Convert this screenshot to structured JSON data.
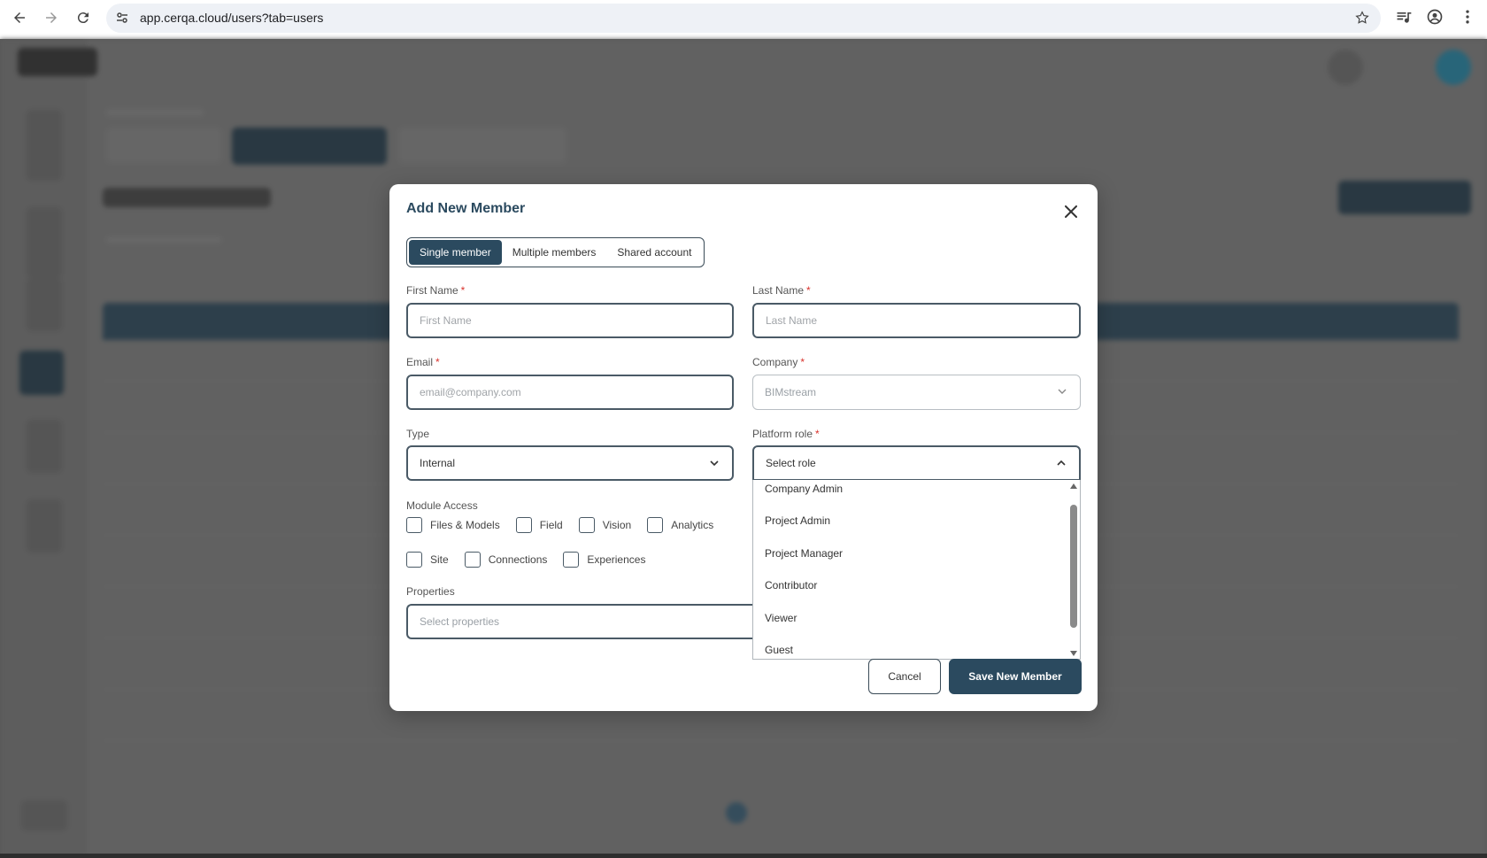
{
  "browser": {
    "url": "app.cerqa.cloud/users?tab=users"
  },
  "modal": {
    "title": "Add New Member",
    "tabs": [
      {
        "label": "Single member",
        "active": true
      },
      {
        "label": "Multiple members",
        "active": false
      },
      {
        "label": "Shared account",
        "active": false
      }
    ],
    "first_name": {
      "label": "First Name",
      "placeholder": "First Name"
    },
    "last_name": {
      "label": "Last Name",
      "placeholder": "Last Name"
    },
    "email": {
      "label": "Email",
      "placeholder": "email@company.com"
    },
    "company": {
      "label": "Company",
      "value": "BIMstream"
    },
    "type": {
      "label": "Type",
      "value": "Internal"
    },
    "platform_role": {
      "label": "Platform role",
      "placeholder": "Select role",
      "options": [
        "Company Admin",
        "Project Admin",
        "Project Manager",
        "Contributor",
        "Viewer",
        "Guest"
      ]
    },
    "module_access": {
      "label": "Module Access",
      "modules": [
        "Files & Models",
        "Field",
        "Vision",
        "Analytics",
        "Site",
        "Connections",
        "Experiences"
      ]
    },
    "properties": {
      "label": "Properties",
      "placeholder": "Select properties"
    },
    "cancel_label": "Cancel",
    "save_label": "Save New Member"
  },
  "colors": {
    "primary": "#2b4a5f",
    "required": "#d9322c"
  }
}
